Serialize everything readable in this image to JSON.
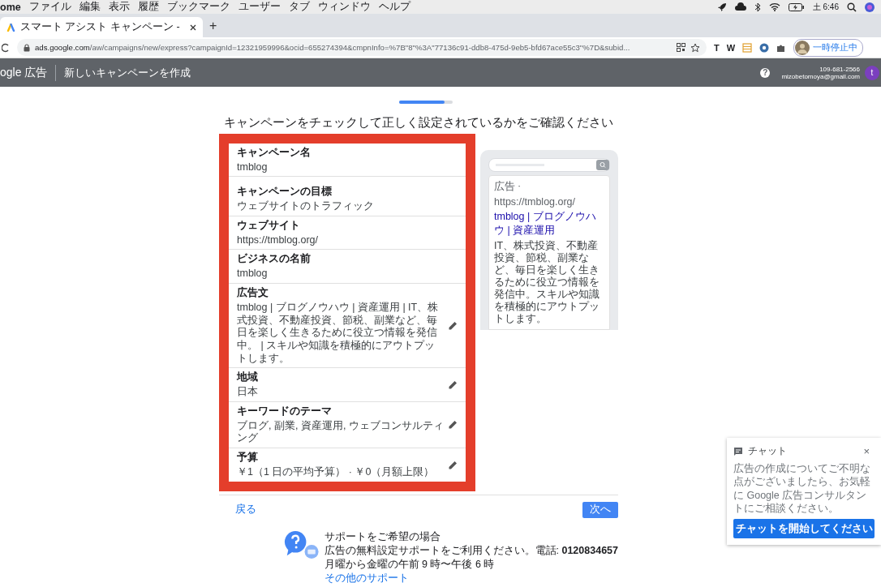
{
  "menu_bar": {
    "app": "ome",
    "items": [
      "ファイル",
      "編集",
      "表示",
      "履歴",
      "ブックマーク",
      "ユーザー",
      "タブ",
      "ウィンドウ",
      "ヘルプ"
    ],
    "clock": "土 6:46"
  },
  "browser": {
    "tab": {
      "title": "スマート アシスト キャンペーン -",
      "selected": true
    },
    "new_tab": "+",
    "url_host": "ads.google.com",
    "url_path": "/aw/campaigns/new/express?campaignId=12321959996&ocid=655274394&cmpnInfo=%7B\"8\"%3A\"77136c91-ddb8-475d-9eb5-bfd67ace55c3\"%7D&subid...",
    "extensions": [
      "T",
      "W"
    ],
    "profile_button": "一時停止中"
  },
  "app_header": {
    "logo": "ogle 広告",
    "title": "新しいキャンペーンを作成",
    "help": "?",
    "phone": "109-681-2566",
    "email": "mizobetomoya@gmail.com",
    "avatar": "t"
  },
  "progress": {
    "level": 0.85
  },
  "heading": "キャンペーンをチェックして正しく設定されているかをご確認ください",
  "summary": [
    {
      "label": "キャンペーン名",
      "value": "tmblog",
      "editable": false
    },
    {
      "label": "キャンペーンの目標",
      "value": "ウェブサイトのトラフィック",
      "editable": false
    },
    {
      "label": "ウェブサイト",
      "value": "https://tmblog.org/",
      "editable": false
    },
    {
      "label": "ビジネスの名前",
      "value": "tmblog",
      "editable": false
    },
    {
      "label": "広告文",
      "value": "tmblog | ブログノウハウ | 資産運用 | IT、株式投資、不動産投資、節税、副業など、毎日を楽しく生きるために役立つ情報を発信中。 | スキルや知識を積極的にアウトプットします。",
      "editable": true
    },
    {
      "label": "地域",
      "value": "日本",
      "editable": true
    },
    {
      "label": "キーワードのテーマ",
      "value": "ブログ, 副業, 資産運用, ウェブコンサルティング",
      "editable": true
    },
    {
      "label": "予算",
      "value": "￥1（1 日の平均予算） · ￥0（月額上限）",
      "editable": true
    }
  ],
  "preview": {
    "ad_label": "広告",
    "separator": "·",
    "url": "https://tmblog.org/",
    "title": "tmblog | ブログノウハウ | 資産運用",
    "description": "IT、株式投資、不動産投資、節税、副業など、毎日を楽しく生きるために役立つ情報を発信中。スキルや知識を積極的にアウトプットします。"
  },
  "nav": {
    "back": "戻る",
    "next": "次へ"
  },
  "support": {
    "title": "サポートをご希望の場合",
    "line": "広告の無料設定サポートをご利用ください。電話: **0120834657**",
    "hours": "月曜から金曜の午前 9 時〜午後 6 時",
    "link": "その他のサポート"
  },
  "chat": {
    "title": "チャット",
    "close": "×",
    "text": "広告の作成についてご不明な点がございましたら、お気軽に Google 広告コンサルタントにご相談ください。",
    "button": "チャットを開始してください"
  }
}
